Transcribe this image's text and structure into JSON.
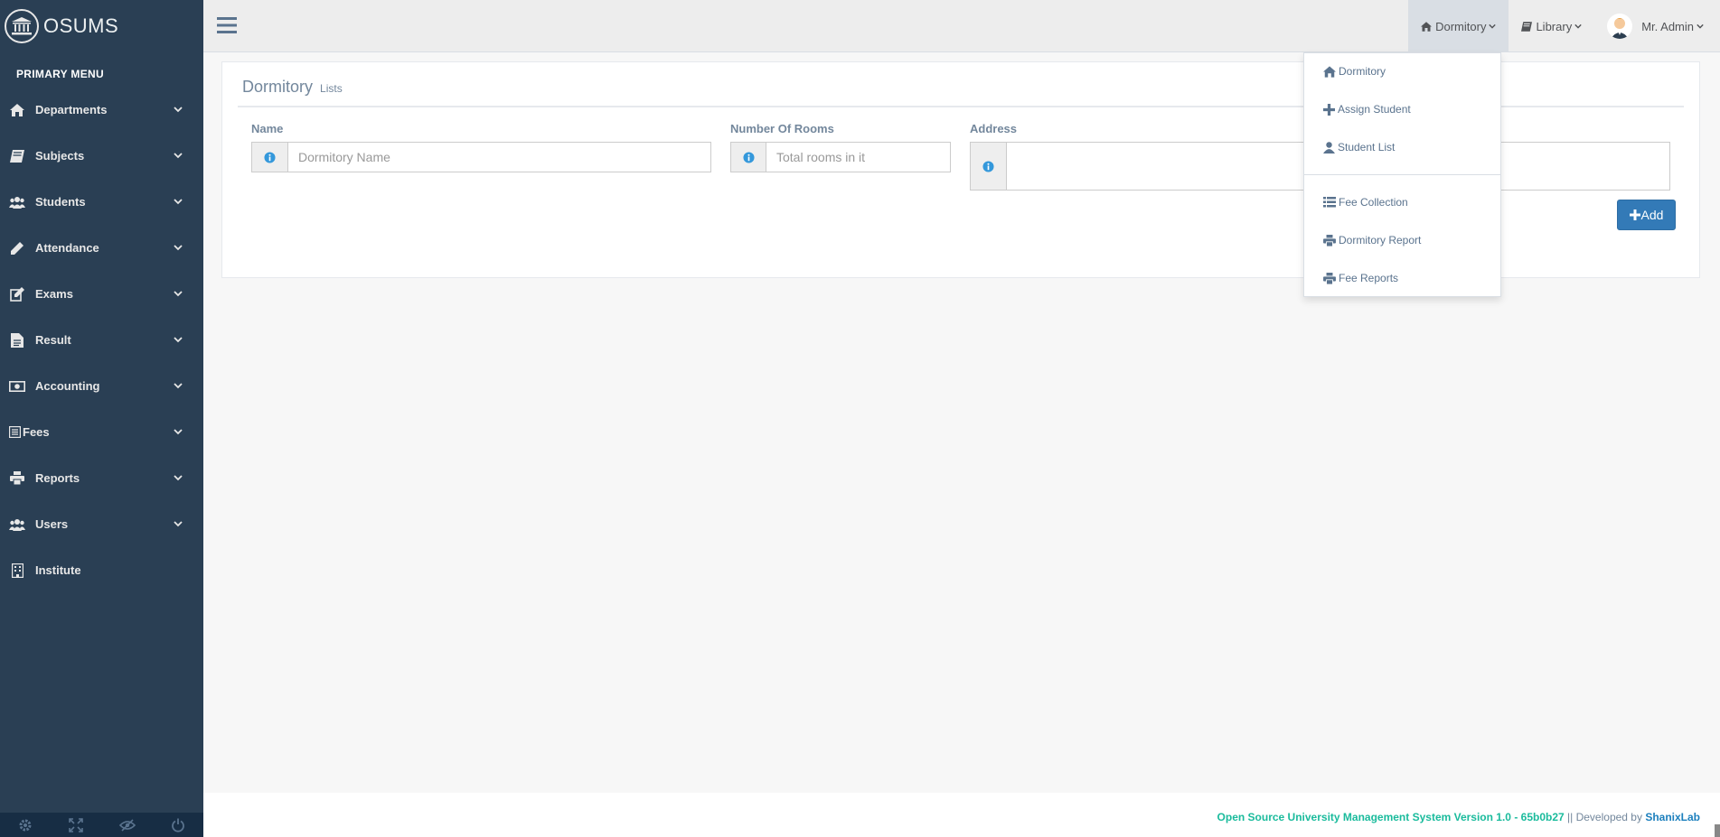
{
  "brand": {
    "name": "OSUMS",
    "icon": "institution-icon"
  },
  "sidebar": {
    "section_title": "PRIMARY MENU",
    "items": [
      {
        "label": "Departments",
        "icon": "home-icon",
        "has_children": true
      },
      {
        "label": "Subjects",
        "icon": "book-icon",
        "has_children": true
      },
      {
        "label": "Students",
        "icon": "users-icon",
        "has_children": true
      },
      {
        "label": "Attendance",
        "icon": "pencil-icon",
        "has_children": true
      },
      {
        "label": "Exams",
        "icon": "edit-icon",
        "has_children": true
      },
      {
        "label": "Result",
        "icon": "file-text-icon",
        "has_children": true
      },
      {
        "label": "Accounting",
        "icon": "money-icon",
        "has_children": true
      },
      {
        "label": "Fees",
        "icon": "list-alt-icon",
        "has_children": true
      },
      {
        "label": "Reports",
        "icon": "print-icon",
        "has_children": true
      },
      {
        "label": "Users",
        "icon": "users-icon",
        "has_children": true
      },
      {
        "label": "Institute",
        "icon": "building-icon",
        "has_children": false
      }
    ],
    "footer_buttons": [
      "settings-icon",
      "fullscreen-icon",
      "lock-icon",
      "power-icon"
    ]
  },
  "topnav": {
    "dormitory_label": "Dormitory",
    "library_label": "Library",
    "user_name": "Mr. Admin"
  },
  "dropdown": {
    "items": [
      {
        "label": "Dormitory",
        "icon": "home-icon"
      },
      {
        "label": "Assign Student",
        "icon": "plus-icon"
      },
      {
        "label": "Student List",
        "icon": "user-icon"
      },
      {
        "label": "Fee Collection",
        "icon": "list-icon"
      },
      {
        "label": "Dormitory Report",
        "icon": "print-icon"
      },
      {
        "label": "Fee Reports",
        "icon": "print-icon"
      }
    ]
  },
  "panel": {
    "title": "Dormitory",
    "subtitle": "Lists",
    "name_label": "Name",
    "name_placeholder": "Dormitory Name",
    "rooms_label": "Number Of Rooms",
    "rooms_placeholder": "Total rooms in it",
    "address_label": "Address",
    "add_label": "Add"
  },
  "footer": {
    "system_text": "Open Source University Management System Version 1.0 - 65b0b27",
    "separator": " || Developed by ",
    "developer": "ShanixLab"
  },
  "colors": {
    "sidebar_bg": "#2a3f54",
    "accent_green": "#1abb9c",
    "primary_blue": "#337ab7",
    "info_blue": "#3498db"
  }
}
